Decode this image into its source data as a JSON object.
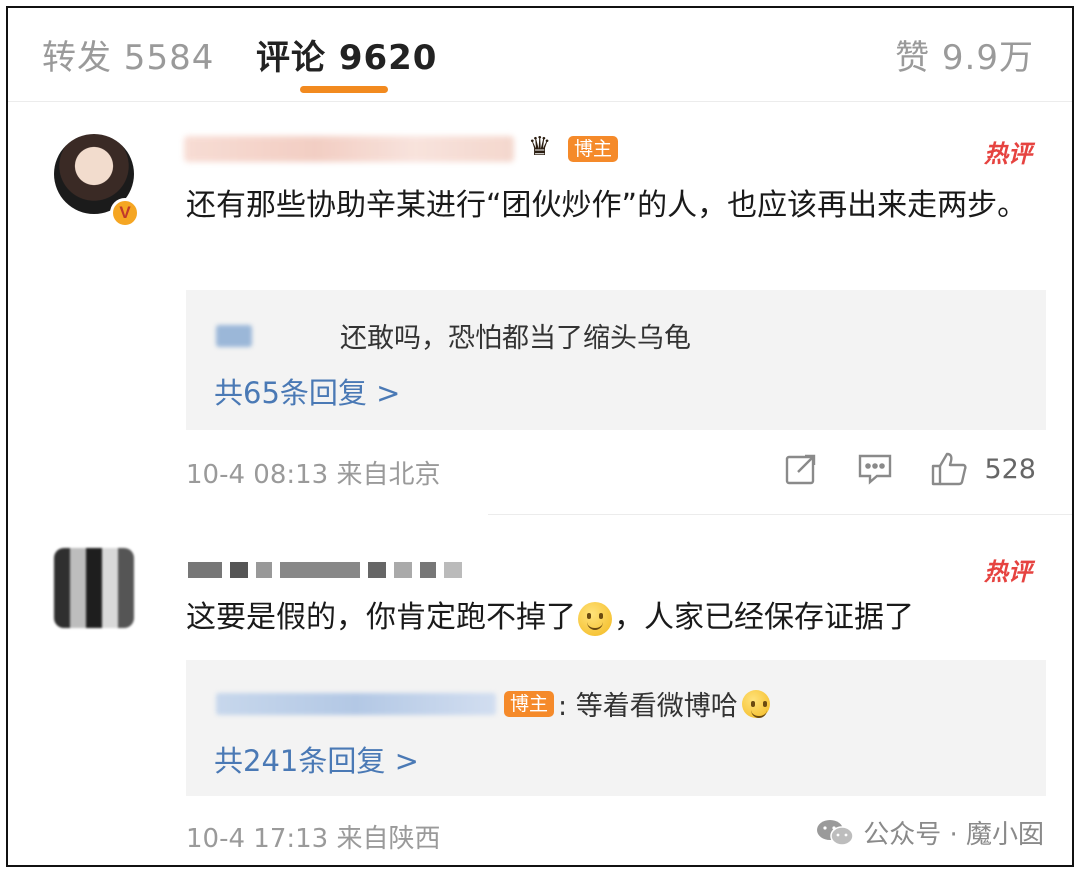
{
  "header": {
    "repost_label": "转发 5584",
    "comment_label": "评论 9620",
    "like_label": "赞 9.9万"
  },
  "comments": [
    {
      "badge": "博主",
      "hot_label": "热评",
      "text": "还有那些协助辛某进行“团伙炒作”的人，也应该再出来走两步。",
      "reply_preview": "还敢吗，恐怕都当了缩头乌龟",
      "reply_more": "共65条回复 >",
      "time_location": "10-4 08:13 来自北京",
      "like_count": "528"
    },
    {
      "hot_label": "热评",
      "text_before_emoji": "这要是假的，你肯定跑不掉了",
      "text_after_emoji": "，人家已经保存证据了",
      "reply_badge": "博主",
      "reply_preview": ": 等着看微博哈",
      "reply_more": "共241条回复 >",
      "time_location": "10-4 17:13 来自陕西"
    }
  ],
  "watermark": {
    "text": "公众号 · 魔小囡"
  },
  "colors": {
    "accent": "#f28a1f",
    "hot": "#e64340",
    "link": "#4a79b5",
    "badge": "#f58a2a"
  }
}
